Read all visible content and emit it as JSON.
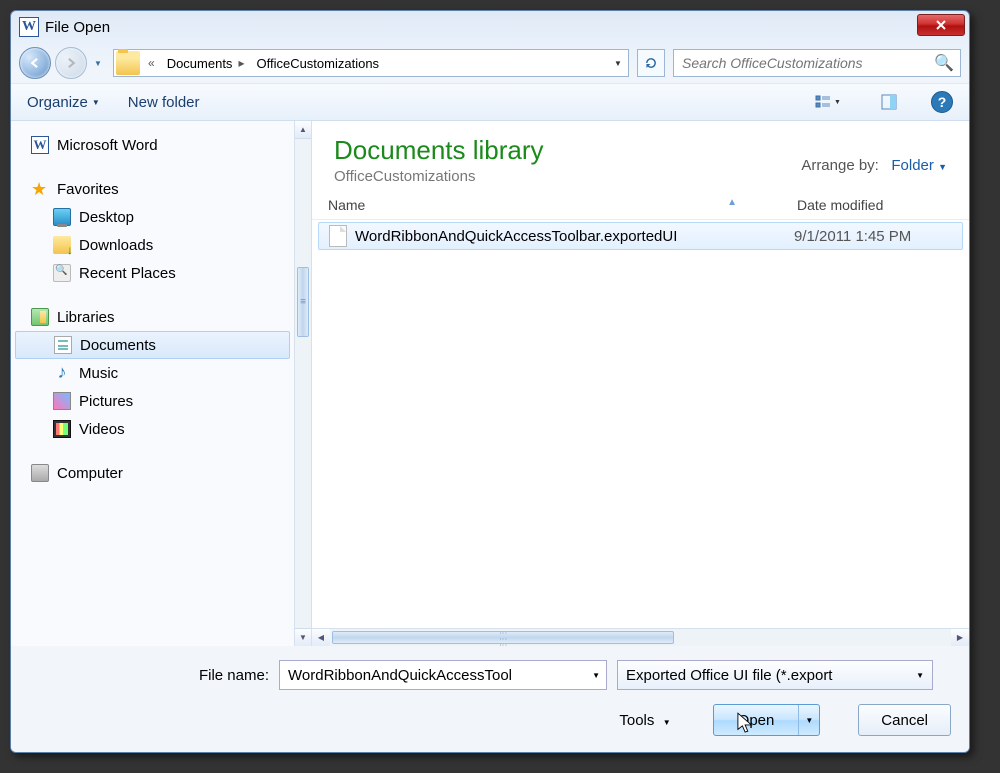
{
  "window": {
    "title": "File Open"
  },
  "breadcrumbs": {
    "prefix_chev": "«",
    "item1": "Documents",
    "item2": "OfficeCustomizations"
  },
  "search": {
    "placeholder": "Search OfficeCustomizations"
  },
  "toolbar": {
    "organize": "Organize",
    "newfolder": "New folder"
  },
  "library": {
    "title": "Documents library",
    "subtitle": "OfficeCustomizations",
    "arrange_label": "Arrange by:",
    "arrange_value": "Folder"
  },
  "columns": {
    "name": "Name",
    "date": "Date modified"
  },
  "sidebar": {
    "msword": "Microsoft Word",
    "favorites": "Favorites",
    "desktop": "Desktop",
    "downloads": "Downloads",
    "recent": "Recent Places",
    "libraries": "Libraries",
    "documents": "Documents",
    "music": "Music",
    "pictures": "Pictures",
    "videos": "Videos",
    "computer": "Computer"
  },
  "files": [
    {
      "name": "WordRibbonAndQuickAccessToolbar.exportedUI",
      "date": "9/1/2011 1:45 PM"
    }
  ],
  "footer": {
    "filename_label": "File name:",
    "filename_value": "WordRibbonAndQuickAccessTool",
    "filetype": "Exported Office UI file (*.export",
    "tools": "Tools",
    "open": "Open",
    "cancel": "Cancel"
  }
}
